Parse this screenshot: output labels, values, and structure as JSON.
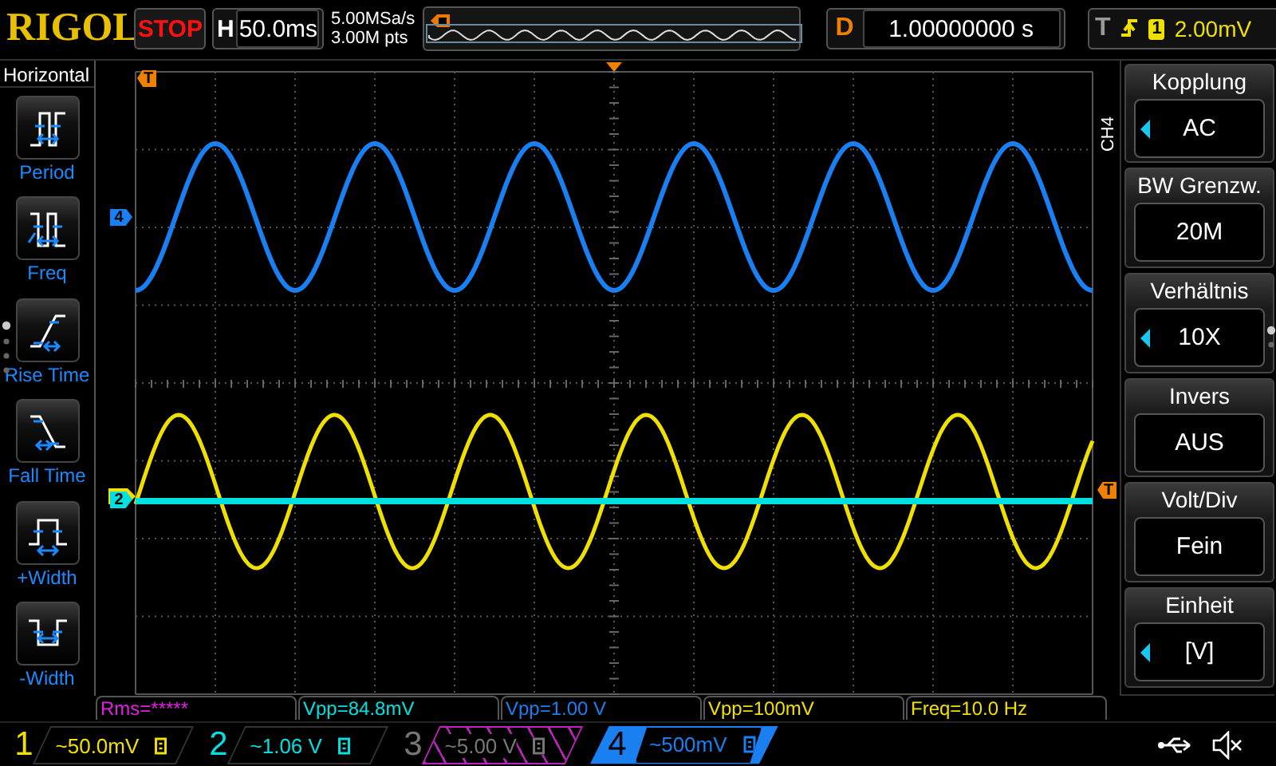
{
  "top_bar": {
    "logo": "RIGOL",
    "run_state": "STOP",
    "timebase": {
      "label": "H",
      "value": "50.0ms"
    },
    "sample_rate": "5.00MSa/s",
    "memory_depth": "3.00M pts",
    "delay": {
      "label": "D",
      "value": "1.00000000 s"
    },
    "trigger": {
      "label": "T",
      "source": "1",
      "level": "2.00mV"
    }
  },
  "left_menu": {
    "title": "Horizontal",
    "items": [
      {
        "kind": "period",
        "label": "Period"
      },
      {
        "kind": "freq",
        "label": "Freq"
      },
      {
        "kind": "rise",
        "label": "Rise Time"
      },
      {
        "kind": "fall",
        "label": "Fall Time"
      },
      {
        "kind": "pwidth",
        "label": "+Width"
      },
      {
        "kind": "nwidth",
        "label": "-Width"
      }
    ]
  },
  "plot": {
    "markers": [
      {
        "kind": "trigger-position",
        "text": "T"
      },
      {
        "kind": "channel",
        "text": "4",
        "color": "#1a7ff0"
      },
      {
        "kind": "channel",
        "text": "2",
        "color": "#00e0e0"
      },
      {
        "kind": "trigger-level",
        "text": "T"
      }
    ]
  },
  "right_menu": {
    "channel": "CH4",
    "items": [
      {
        "header": "Kopplung",
        "value": "AC",
        "adjustable": true
      },
      {
        "header": "BW Grenzw.",
        "value": "20M",
        "adjustable": false
      },
      {
        "header": "Verhältnis",
        "value": "10X",
        "adjustable": true
      },
      {
        "header": "Invers",
        "value": "AUS",
        "adjustable": false
      },
      {
        "header": "Volt/Div",
        "value": "Fein",
        "adjustable": false
      },
      {
        "header": "Einheit",
        "value": "[V]",
        "adjustable": true
      }
    ]
  },
  "measurements": [
    {
      "text": "Rms=*****",
      "color": "#e020e0"
    },
    {
      "text": "Vpp=84.8mV",
      "color": "#00e0e0"
    },
    {
      "text": "Vpp=1.00 V",
      "color": "#1a7ff0"
    },
    {
      "text": "Vpp=100mV",
      "color": "#f0e000"
    },
    {
      "text": "Freq=10.0 Hz",
      "color": "#f0e000"
    }
  ],
  "channels": [
    {
      "number": "1",
      "scale": "~50.0mV",
      "color": "#f0e000",
      "on": true,
      "selected": false
    },
    {
      "number": "2",
      "scale": "~1.06 V",
      "color": "#00e0e0",
      "on": true,
      "selected": false
    },
    {
      "number": "3",
      "scale": "~5.00 V",
      "color": "#c020c0",
      "on": false,
      "selected": false
    },
    {
      "number": "4",
      "scale": "~500mV",
      "color": "#1a7ff0",
      "on": true,
      "selected": true
    }
  ]
}
